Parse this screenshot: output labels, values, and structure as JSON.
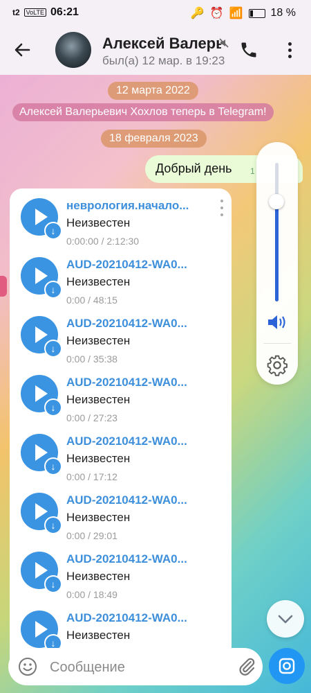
{
  "status_bar": {
    "carrier": "t2",
    "network_badge": "VoLTE",
    "time": "06:21",
    "battery": "18 %"
  },
  "header": {
    "contact_name": "Алексей Валерь",
    "last_seen": "был(а) 12 мар. в 19:23"
  },
  "messages": {
    "date_1": "12 марта 2022",
    "service_message": "Алексей Валерьевич Хохлов теперь в Telegram!",
    "date_2": "18 февраля 2023",
    "outgoing": {
      "text": "Добрый день",
      "time": "1"
    }
  },
  "audio_files": [
    {
      "title": "неврология.начало...",
      "artist": "Неизвестен",
      "time": "0:00:00 / 2:12:30"
    },
    {
      "title": "AUD-20210412-WA0...",
      "artist": "Неизвестен",
      "time": "0:00 / 48:15"
    },
    {
      "title": "AUD-20210412-WA0...",
      "artist": "Неизвестен",
      "time": "0:00 / 35:38"
    },
    {
      "title": "AUD-20210412-WA0...",
      "artist": "Неизвестен",
      "time": "0:00 / 27:23"
    },
    {
      "title": "AUD-20210412-WA0...",
      "artist": "Неизвестен",
      "time": "0:00 / 17:12"
    },
    {
      "title": "AUD-20210412-WA0...",
      "artist": "Неизвестен",
      "time": "0:00 / 29:01"
    },
    {
      "title": "AUD-20210412-WA0...",
      "artist": "Неизвестен",
      "time": "0:00 / 18:49"
    },
    {
      "title": "AUD-20210412-WA0...",
      "artist": "Неизвестен",
      "time": ""
    }
  ],
  "volume_panel": {
    "level": 0.72
  },
  "composer": {
    "placeholder": "Сообщение"
  },
  "colors": {
    "accent": "#3a94e2",
    "send": "#2196f3",
    "outgoing_bubble": "#e9fbd7"
  },
  "icons": [
    "back-arrow-icon",
    "mute-icon",
    "phone-icon",
    "more-vert-icon",
    "play-icon",
    "download-icon",
    "speaker-icon",
    "gear-icon",
    "chevron-down-icon",
    "emoji-icon",
    "paperclip-icon",
    "camera-icon"
  ]
}
